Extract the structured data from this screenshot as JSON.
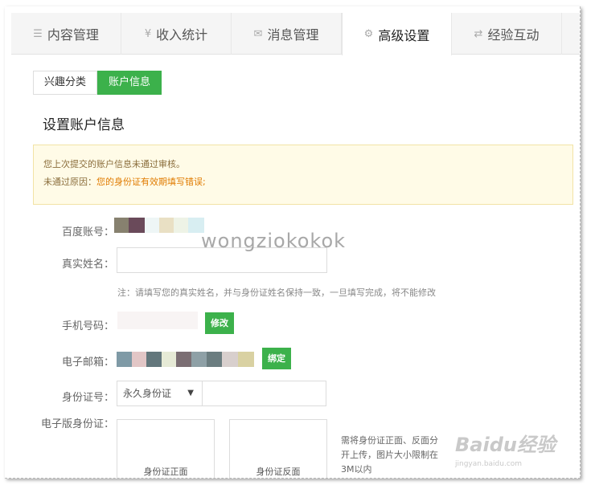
{
  "tabs": [
    {
      "icon": "list-icon",
      "glyph": "☰",
      "label": "内容管理",
      "active": false
    },
    {
      "icon": "yen-icon",
      "glyph": "¥",
      "label": "收入统计",
      "active": false
    },
    {
      "icon": "mail-icon",
      "glyph": "✉",
      "label": "消息管理",
      "active": false
    },
    {
      "icon": "gear-icon",
      "glyph": "⚙",
      "label": "高级设置",
      "active": true
    },
    {
      "icon": "exchange-icon",
      "glyph": "⇄",
      "label": "经验互动",
      "active": false
    }
  ],
  "subtabs": [
    {
      "label": "兴趣分类",
      "active": false
    },
    {
      "label": "账户信息",
      "active": true
    }
  ],
  "section_title": "设置账户信息",
  "notice": {
    "line1": "您上次提交的账户信息未通过审核。",
    "line2_prefix": "未通过原因：",
    "line2_reason": "您的身份证有效期填写错误;"
  },
  "form": {
    "baidu_account_label": "百度账号：",
    "real_name_label": "真实姓名：",
    "real_name_value": "",
    "real_name_note": "注：请填写您的真实姓名，并与身份证姓名保持一致，一旦填写完成，将不能修改",
    "phone_label": "手机号码：",
    "phone_button": "修改",
    "email_label": "电子邮箱：",
    "email_button": "绑定",
    "id_label": "身份证号：",
    "id_type_selected": "永久身份证",
    "id_number_value": "",
    "id_scan_label": "电子版身份证：",
    "id_front": "身份证正面",
    "id_back": "身份证反面",
    "upload_hint": "需将身份证正面、反面分开上传，图片大小限制在3M以内"
  },
  "watermarks": {
    "middle": "wongziokokok",
    "baidu": "Baidu经验",
    "baidu_url": "jingyan.baidu.com"
  },
  "colors": {
    "accent_green": "#3cb14b",
    "notice_bg": "#fffbe7",
    "notice_reason": "#e07b00"
  }
}
